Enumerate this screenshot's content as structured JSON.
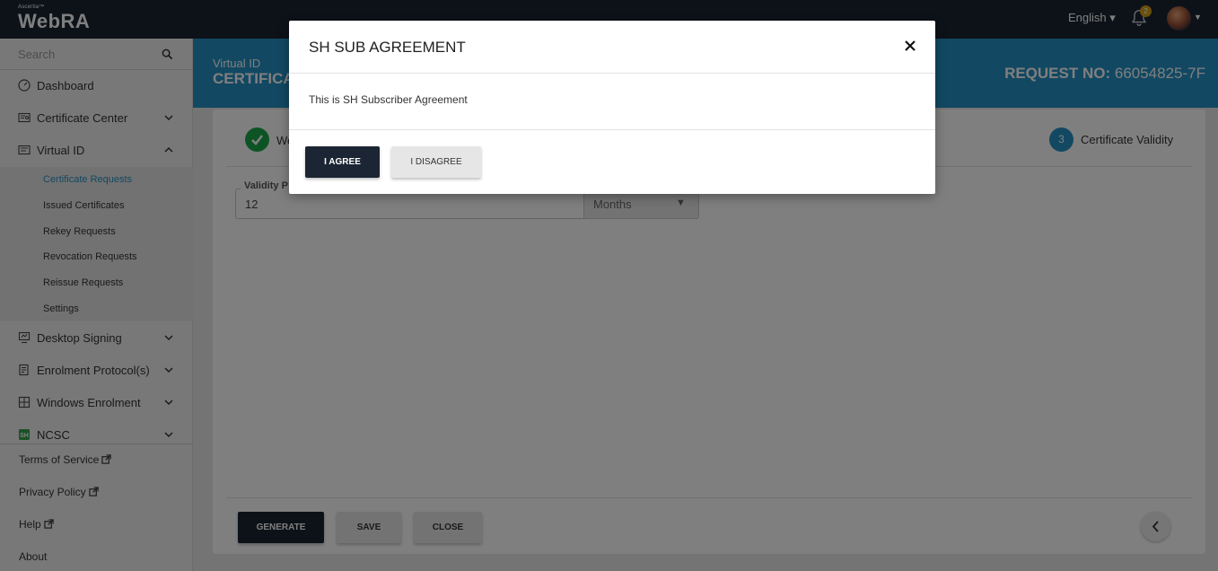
{
  "topbar": {
    "brand_small": "Ascertia™",
    "brand_main": "WebRA",
    "language": "English ▾",
    "notification_count": "2"
  },
  "sidebar": {
    "search_placeholder": "Search",
    "items": [
      {
        "label": "Dashboard",
        "icon": "dashboard-icon"
      },
      {
        "label": "Certificate Center",
        "icon": "certificate-icon"
      },
      {
        "label": "Virtual ID",
        "icon": "virtual-id-icon"
      }
    ],
    "sub_items": [
      {
        "label": "Certificate Requests",
        "active": true
      },
      {
        "label": "Issued Certificates"
      },
      {
        "label": "Rekey Requests"
      },
      {
        "label": "Revocation Requests"
      },
      {
        "label": "Reissue Requests"
      },
      {
        "label": "Settings"
      }
    ],
    "items_after": [
      {
        "label": "Desktop Signing",
        "icon": "desktop-signing-icon"
      },
      {
        "label": "Enrolment Protocol(s)",
        "icon": "enrolment-protocol-icon"
      },
      {
        "label": "Windows Enrolment",
        "icon": "windows-icon"
      },
      {
        "label": "NCSC",
        "icon": "sh-icon"
      }
    ],
    "footer": {
      "terms": "Terms of Service",
      "privacy": "Privacy Policy",
      "help": "Help",
      "about": "About"
    }
  },
  "header": {
    "subtitle": "Virtual ID",
    "title": "CERTIFICA",
    "request_label": "REQUEST NO:",
    "request_number": "66054825-7F"
  },
  "steps": {
    "step1_text": "We",
    "step3_number": "3",
    "step3_label": "Certificate Validity"
  },
  "form": {
    "validity_label": "Validity P",
    "validity_value": "12",
    "unit_value": "Months"
  },
  "actions": {
    "generate": "GENERATE",
    "save": "SAVE",
    "close": "CLOSE"
  },
  "modal": {
    "title": "SH SUB AGREEMENT",
    "body": "This is SH Subscriber Agreement",
    "agree": "I AGREE",
    "disagree": "I DISAGREE"
  },
  "colors": {
    "topbar": "#1b2533",
    "accent": "#2590c4",
    "success": "#1aa84b",
    "badge": "#d4a017"
  }
}
